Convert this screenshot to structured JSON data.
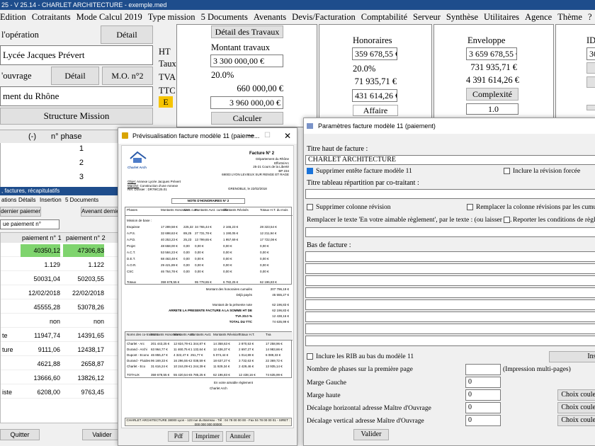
{
  "app": {
    "title": "25 - V 25.14 - CHARLET ARCHITECTURE - exemple.med"
  },
  "menu": [
    "Edition",
    "Cotraitants",
    "Mode Calcul 2019",
    "Type mission",
    "5 Documents",
    "Avenants",
    "Devis/Facturation",
    "Comptabilité",
    "Serveur",
    "Synthèse",
    "Utilitaires",
    "Agence",
    "Thème",
    "?"
  ],
  "operation": {
    "label": "l'opération",
    "detail_button": "Détail",
    "name": "Lycée Jacques Prévert",
    "ouvrage_label": "'ouvrage",
    "ouvrage_detail_button": "Détail",
    "mo2_button": "M.O. n°2",
    "mo_name": "ment du Rhône",
    "structure_button": "Structure Mission"
  },
  "amounts": {
    "ht_label": "HT",
    "taux_label": "Taux",
    "tva_label": "TVA",
    "ttc_label": "TTC",
    "e_label": "E",
    "detail_travaux_button": "Détail des Travaux",
    "montant_travaux_label": "Montant travaux",
    "montant_ht": "3 300 000,00 €",
    "taux": "20.0%",
    "tva": "660 000,00 €",
    "ttc": "3 960 000,00 €",
    "calculer_button": "Calculer"
  },
  "honoraires": {
    "title": "Honoraires",
    "ht": "359 678,55 €",
    "taux": "20.0%",
    "tva": "71 935,71 €",
    "ttc": "431 614,26 €",
    "affaire_button": "Affaire"
  },
  "enveloppe": {
    "title": "Enveloppe",
    "ht": "3 659 678,55 €",
    "tva": "731 935,71 €",
    "ttc": "4 391 614,26 €",
    "complexite_button": "Complexité",
    "complexite_value": "1.0"
  },
  "right_edge": {
    "label": "ID",
    "value": "30"
  },
  "phases": {
    "col_a": "(-)",
    "col_b": "n° phase",
    "rows": [
      "1",
      "2",
      "3"
    ]
  },
  "facturation": {
    "title": ", factures, récapitulatifs",
    "tabs": [
      "ations",
      "Détails",
      "Insertion",
      "5 Documents"
    ],
    "dernier_paiement_button": "dernier paiement",
    "avenant_button": "Avenant dernier",
    "paiement_select": "ue paiement n°",
    "col1": "paiement n° 1",
    "col2": "paiement n° 2",
    "rows": [
      {
        "label": "",
        "v1": "40350,12",
        "v2": "47306,83",
        "highlight": true
      },
      {
        "label": "",
        "v1": "1.129",
        "v2": "1.122"
      },
      {
        "label": "",
        "v1": "50031,04",
        "v2": "50203,55"
      },
      {
        "label": "",
        "v1": "12/02/2018",
        "v2": "22/02/2018"
      },
      {
        "label": "",
        "v1": "45555,28",
        "v2": "53078,26"
      },
      {
        "label": "",
        "v1": "non",
        "v2": "non"
      },
      {
        "label": "te",
        "v1": "11947,74",
        "v2": "14391,65"
      },
      {
        "label": "ture",
        "v1": "9111,06",
        "v2": "12438,17"
      },
      {
        "label": "",
        "v1": "4621,88",
        "v2": "2658,87"
      },
      {
        "label": "",
        "v1": "13666,60",
        "v2": "13826,12"
      },
      {
        "label": "iste",
        "v1": "6208,00",
        "v2": "9763,45"
      }
    ],
    "quitter_button": "Quitter",
    "valider_button": "Valider"
  },
  "preview": {
    "title": "Prévisualisation facture modèle 11 (paieme...",
    "pdf_button": "Pdf",
    "print_button": "Imprimer",
    "cancel_button": "Annuler",
    "invoice": {
      "logo_text": "Charlet Arch",
      "facture_no": "Facture N° 2",
      "client_lines": [
        "Département du Rhône",
        "Efforts/Arc",
        "25-21 Cours de la Liberté",
        "BP 234",
        "69003 LYON LEVIEUX SUR RENGE ET RAGE"
      ],
      "objet_label": "Objet:",
      "objet": "Annexe Lycée Jacques Prévert",
      "marche_label": "Marché:",
      "marche": "Construction d'une Annexe",
      "ref_label": "Réf. Dossier :",
      "ref": "DR79/C25.01",
      "city_date": "GRENOBLE, le 22/02/2018",
      "honoraires_heading": "NOTE D'HONORAIRES N° 2",
      "head_cols": [
        "Phases",
        "Montants Honoraires",
        "Avct. cum.",
        "Montants Avct. cumulés",
        "Montants Révisés",
        "Totaux H.T. du mois"
      ],
      "rows": [
        [
          "Mission de base :",
          "",
          "",
          "",
          "",
          ""
        ],
        [
          "Esquisse",
          "17 289,58 €",
          "225,32",
          "34 765,44 €",
          "2 165,23 €",
          "28 323,54 €"
        ],
        [
          "A.P.S.",
          "32 698,63 €",
          "89,25",
          "27 731,78 €",
          "1 190,05 €",
          "12 211,94 €"
        ],
        [
          "A.P.D.",
          "40 253,23 €",
          "25,23",
          "13 799,65 €",
          "1 957,69 €",
          "17 722,08 €"
        ],
        [
          "Projet",
          "48 658,00 €",
          "0,00",
          "0,00 €",
          "0,00 €",
          "0,00 €"
        ],
        [
          "A.C.T.",
          "53 584,23 €",
          "0,00",
          "0,00 €",
          "0,00 €",
          "0,00 €"
        ],
        [
          "D.E.T.",
          "68 463,48 €",
          "0,00",
          "0,00 €",
          "0,00 €",
          "0,00 €"
        ],
        [
          "A.O.R.",
          "29 421,89 €",
          "0,00",
          "0,00 €",
          "0,00 €",
          "0,00 €"
        ],
        [
          "CSC",
          "46 764,78 €",
          "0,00",
          "0,00 €",
          "0,00 €",
          "0,00 €"
        ],
        [
          "Totaux",
          "359 678,55 €",
          "",
          "95 778,65 €",
          "6 782,25 €",
          "62 196,83 €"
        ]
      ],
      "summary": [
        [
          "Montant des honoraires cumulés",
          "207 796,19 €"
        ],
        [
          "Déjà payés",
          "45 555,27 €"
        ],
        [
          "Montant de la présente note",
          "62 196,83 €"
        ],
        [
          "ARRETE LA PRESENTE FACTURE A LA SOMME HT DE",
          "62 196,83 €"
        ],
        [
          "TVA 20.0 %",
          "12 438,16 €"
        ],
        [
          "TOTAL DU TTC",
          "74 635,99 €"
        ]
      ],
      "co_cols": [
        "Noms des co-traitants",
        "Montants Honoraires",
        "Montants Avct.",
        "Montants Avct.",
        "Montants Révision",
        "Totaux H.T.",
        "Tva",
        "TTC"
      ],
      "co_rows": [
        [
          "Charlet - Arc",
          "201 443,25 €",
          "12 824,79 €",
          "1 344,87 €",
          "14 358,63 €",
          "2 870,53 €",
          "17 258,96 €"
        ],
        [
          "Durand - Archi",
          "63 964,77 €",
          "11 460,75 €",
          "1 132,64 €",
          "12 436,37 €",
          "2 697,27 €",
          "14 983,66 €"
        ],
        [
          "Dupont - Econo",
          "46 855,47 €",
          "4 322,47 €",
          "251,77 €",
          "5 074,44 €",
          "1 014,89 €",
          "6 089,33 €"
        ],
        [
          "Durand - Fluides",
          "96 169,33 €",
          "16 296,55 €",
          "2 038,59 €",
          "18 637,27 €",
          "3 732,63 €",
          "22 369,72 €"
        ],
        [
          "Charlet - Eco",
          "31 616,24 €",
          "10 244,09 €",
          "1 244,39 €",
          "11 929,34 €",
          "2 429,46 €",
          "13 935,14 €"
        ],
        [
          "TOTAUX",
          "359 678,55 €",
          "55 420,54 €",
          "6 785,25 €",
          "62 196,83 €",
          "12 438,16 €",
          "74 635,99 €"
        ]
      ],
      "closing": "En votre aimable règlement",
      "signature": "Charlet Arch",
      "footer": "CHARLET ARCHITECTURE 38000 Lyon - 123 rue du Barreau - Tél : 04 78 00 00 00 - Fax 04 78 00 00 01 - SIRET : 000 000 000 00000"
    }
  },
  "params": {
    "title": "Paramètres facture modèle 11 (paiement)",
    "titre_haut_label": "Titre haut de facture :",
    "titre_haut_value": "CHARLET ARCHITECTURE",
    "supprimer_entete_label": "Supprimer entête facture modèle 11",
    "inclure_revision_label": "Inclure la révision forcée",
    "titre_tableau_label": "Titre tableau répartition par co-traitant :",
    "supprimer_colonne_label": "Supprimer colonne révision",
    "remplacer_colonne_label": "Remplacer la colonne révisions par les cumuls a",
    "remplacer_texte_label": "Remplacer le texte 'En votre aimable règlement', par le texte :  (ou laisser v...",
    "reporter_label": "Reporter les conditions de règlem",
    "bas_label": "Bas de facture :",
    "inclure_rib_label": "Inclure les RIB au bas du modèle 11",
    "inse_button": "Inse",
    "nb_phases_label": "Nombre de phases sur la première page",
    "impression_label": "(Impression multi-pages)",
    "marge_gauche_label": "Marge Gauche",
    "marge_gauche_value": "0",
    "marge_haute_label": "Marge haute",
    "marge_haute_value": "0",
    "decalage_h_label": "Décalage horizontal adresse Maître d'Ouvrage",
    "decalage_h_value": "0",
    "decalage_v_label": "Décalage vertical adresse Maître d'Ouvrage",
    "decalage_v_value": "0",
    "choix_couleur": "Choix couleu",
    "valider_button": "Valider"
  }
}
